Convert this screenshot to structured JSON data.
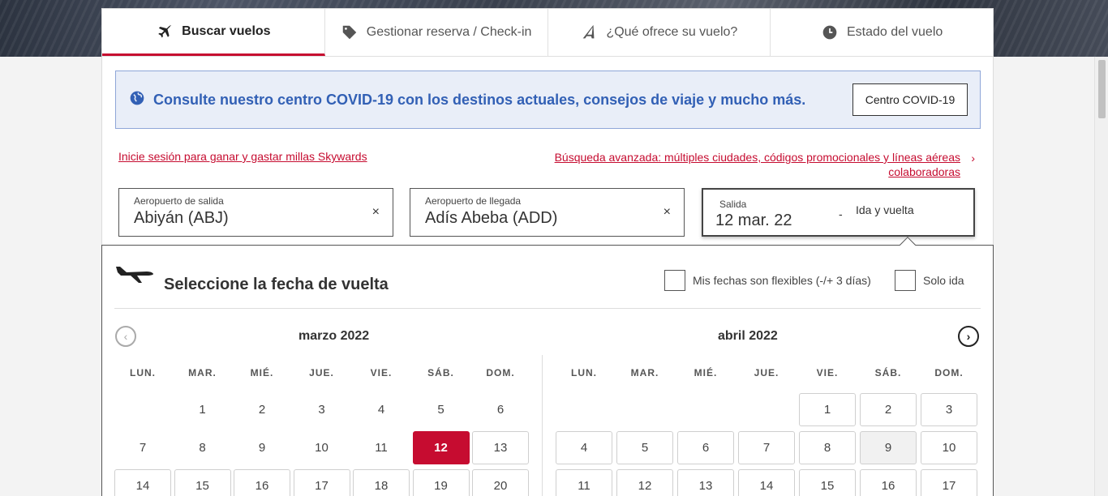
{
  "tabs": [
    {
      "label": "Buscar vuelos",
      "icon": "plane-icon"
    },
    {
      "label": "Gestionar reserva / Check-in",
      "icon": "tag-icon"
    },
    {
      "label": "¿Qué ofrece su vuelo?",
      "icon": "seat-icon"
    },
    {
      "label": "Estado del vuelo",
      "icon": "clock-icon"
    }
  ],
  "covid": {
    "text": "Consulte nuestro centro COVID-19 con los destinos actuales, consejos de viaje y mucho más.",
    "button": "Centro COVID-19"
  },
  "links": {
    "login": "Inicie sesión para ganar y gastar millas Skywards",
    "advanced": "Búsqueda avanzada: múltiples ciudades, códigos promocionales y líneas aéreas colaboradoras"
  },
  "fields": {
    "origin": {
      "label": "Aeropuerto de salida",
      "value": "Abiyán (ABJ)"
    },
    "destination": {
      "label": "Aeropuerto de llegada",
      "value": "Adís Abeba (ADD)"
    },
    "dates": {
      "label": "Salida",
      "value": "12  mar. 22",
      "separator": "-",
      "trip": "Ida y vuelta"
    },
    "clear_glyph": "×"
  },
  "picker": {
    "title": "Seleccione la fecha de vuelta",
    "flexible": "Mis fechas son flexibles (-/+ 3 días)",
    "one_way": "Solo ida",
    "weekdays": [
      "LUN.",
      "MAR.",
      "MIÉ.",
      "JUE.",
      "VIE.",
      "SÁB.",
      "DOM."
    ],
    "months": [
      {
        "name": "marzo 2022",
        "offset": 1,
        "days": [
          1,
          2,
          3,
          4,
          5,
          6,
          7,
          8,
          9,
          10,
          11,
          12,
          13,
          14,
          15,
          16,
          17,
          18,
          19,
          20
        ],
        "boxed_from": 13,
        "selected": 12,
        "grey": []
      },
      {
        "name": "abril 2022",
        "offset": 4,
        "days": [
          1,
          2,
          3,
          4,
          5,
          6,
          7,
          8,
          9,
          10,
          11,
          12,
          13,
          14,
          15,
          16,
          17
        ],
        "boxed_from": 1,
        "selected": null,
        "grey": [
          9
        ]
      }
    ]
  },
  "colors": {
    "accent": "#c60c30",
    "covid_blue": "#3260b5"
  }
}
